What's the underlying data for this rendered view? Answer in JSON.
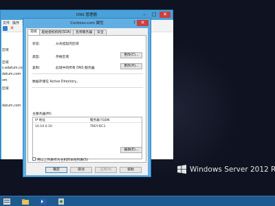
{
  "dns_manager": {
    "title": "DNS 管理器",
    "menu": [
      "文件",
      "操作",
      "查看"
    ],
    "tree_items": [
      "区域",
      "区域",
      "s.adatum.com",
      "datum.com",
      "om",
      "区域",
      "datum.com"
    ]
  },
  "dialog": {
    "title": "Contoso.com 属性",
    "help_glyph": "?",
    "close_glyph": "✕",
    "tabs": [
      "常规",
      "起始授权机构(SOA)",
      "名称服务器",
      "安全"
    ],
    "status_label": "状态:",
    "status_value": "从未挂起的区域",
    "type_label": "类型:",
    "type_value": "存根区域",
    "type_button": "更改(C)...",
    "replication_label": "复制:",
    "replication_value": "此域中的所有 DNS 服务器",
    "replication_button": "更改(H)...",
    "ad_note": "数据存储在 Active Directory。",
    "master_servers_label": "主服务器(M):",
    "table": {
      "columns": [
        "IP 地址",
        "服务器 FQDN"
      ],
      "rows": [
        [
          "10.10.0.10",
          "TREY-DC1"
        ]
      ]
    },
    "edit_button": "编辑(E)...",
    "checkbox_label": "用以上列表作为主机的本地列表(S)",
    "checkbox_checked": false,
    "ok_button": "确定",
    "cancel_button": "取消",
    "apply_button": "应用(A)",
    "help_button": "帮助"
  },
  "branding": {
    "text": "Windows Server 2012 R2"
  },
  "colors": {
    "desktop_bg": "#0f1220",
    "window_frame": "#61aee3",
    "taskbar": "#1c5a8f",
    "close_button": "#c94040"
  },
  "taskbar_icons": [
    "server-manager-icon",
    "folder-icon",
    "powershell-icon",
    "dns-icon"
  ]
}
